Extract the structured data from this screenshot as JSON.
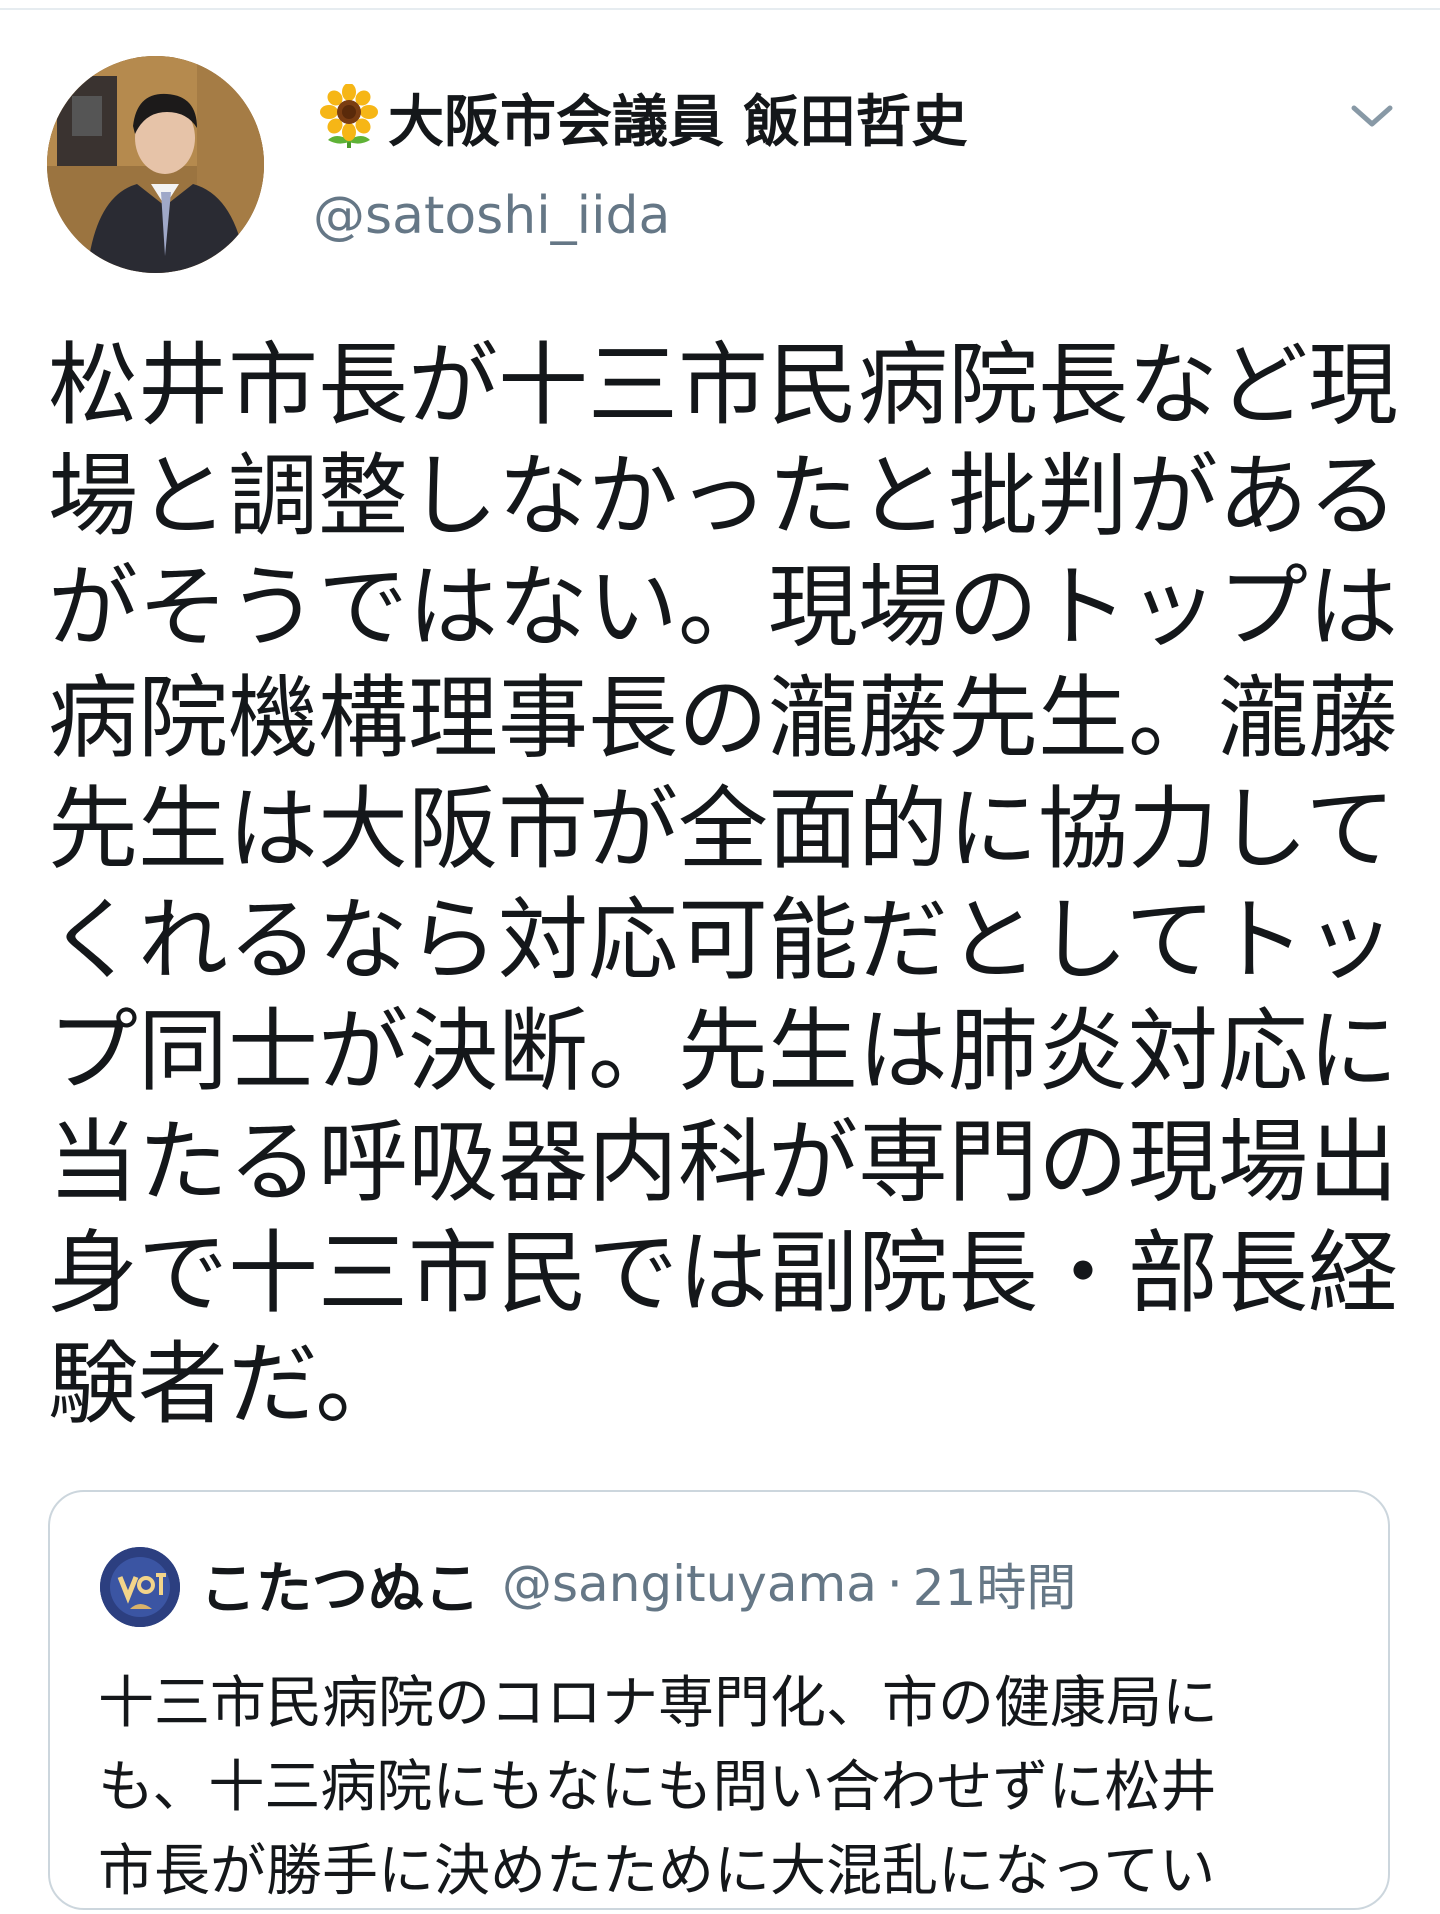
{
  "author": {
    "display_name": "大阪市会議員 飯田哲史",
    "name_prefix_icon": "sunflower-icon",
    "handle": "@satoshi_iida"
  },
  "tweet": {
    "lines": [
      "松井市長が十三市民病院長など現",
      "場と調整しなかったと批判がある",
      "がそうではない。現場のトップは",
      "病院機構理事長の瀧藤先生。瀧藤",
      "先生は大阪市が全面的に協力して",
      "くれるなら対応可能だとしてトッ",
      "プ同士が決断。先生は肺炎対応に",
      "当たる呼吸器内科が専門の現場出",
      "身で十三市民では副院長・部長経",
      "験者だ。"
    ]
  },
  "quoted_tweet": {
    "name": "こたつぬこ",
    "handle": "@sangituyama",
    "separator": "·",
    "time": "21時間",
    "lines": [
      "十三市民病院のコロナ専門化、市の健康局に",
      "も、十三病院にもなにも問い合わせずに松井",
      "市長が勝手に決めたために大混乱になってい"
    ]
  },
  "icons": {
    "menu": "chevron-down-icon",
    "avatar": "profile-photo",
    "quote_avatar": "vote-avatar"
  },
  "colors": {
    "text": "#14171a",
    "secondary": "#657786",
    "border": "#ccd6dd"
  }
}
